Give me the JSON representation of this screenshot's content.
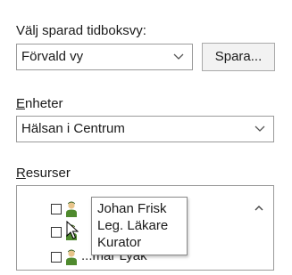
{
  "saved_view": {
    "label": "Välj sparad tidboksvy:",
    "selected": "Förvald vy",
    "save_button": "Spara..."
  },
  "units": {
    "label_accel": "E",
    "label_rest": "nheter",
    "selected": "Hälsan i Centrum"
  },
  "resources": {
    "label_accel": "R",
    "label_rest": "esurser",
    "bottom_row_partial_text": "...mar Lyak"
  },
  "tooltip": {
    "lines": [
      "Johan Frisk",
      "Leg. Läkare",
      "Kurator"
    ]
  },
  "icons": {
    "combo_arrow": "chevron-down-icon",
    "scroll_up": "chevron-up-icon",
    "person": "person-icon",
    "cursor": "mouse-pointer-icon"
  },
  "colors": {
    "person_skin": "#e8c48a",
    "person_shirt": "#4f8a2e",
    "person_hair": "#2e5a1a"
  }
}
